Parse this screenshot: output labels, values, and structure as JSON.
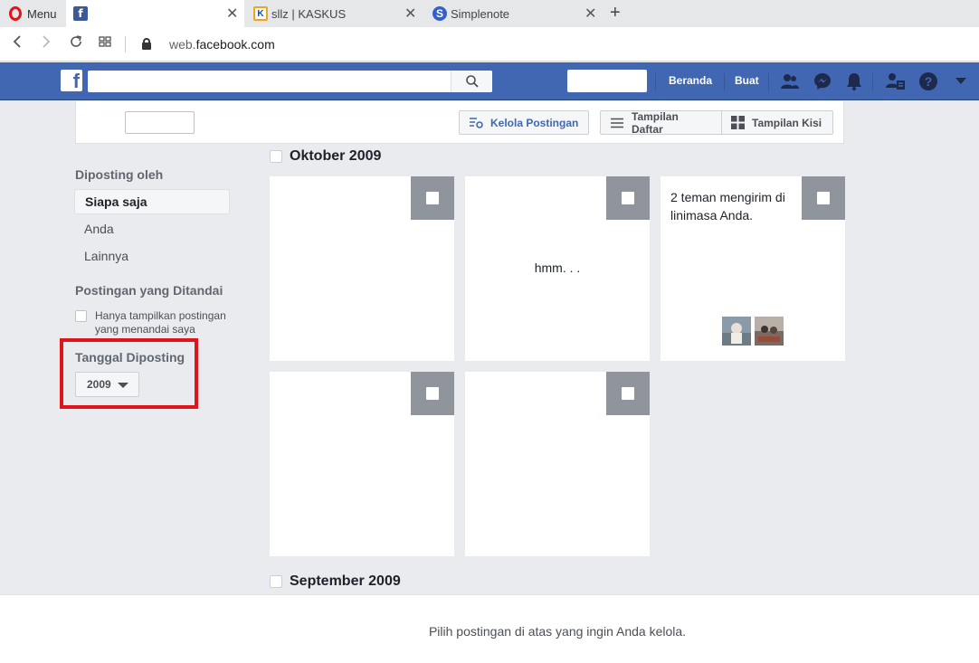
{
  "browser": {
    "menu_label": "Menu",
    "tabs": [
      {
        "label": "",
        "favicon": "facebook-icon"
      },
      {
        "label": "sllz | KASKUS",
        "favicon": "kaskus-icon"
      },
      {
        "label": "Simplenote",
        "favicon": "simplenote-icon"
      }
    ],
    "url_prefix": "web.",
    "url_domain": "facebook.com"
  },
  "fb_header": {
    "logo": "f",
    "search_placeholder": "",
    "home_link": "Beranda",
    "create_link": "Buat",
    "brand_color": "#4267b2"
  },
  "toolbar": {
    "manage_posts": "Kelola Postingan",
    "list_view": "Tampilan Daftar",
    "grid_view": "Tampilan Kisi"
  },
  "sidebar": {
    "posted_by_heading": "Diposting oleh",
    "posted_by_options": [
      "Siapa saja",
      "Anda",
      "Lainnya"
    ],
    "selected_option": "Siapa saja",
    "tagged_heading": "Postingan yang Ditandai",
    "tagged_checkbox_label": "Hanya tampilkan postingan yang menandai saya",
    "date_heading": "Tanggal Diposting",
    "year_value": "2009"
  },
  "months": [
    {
      "label": "Oktober 2009",
      "posts": [
        {
          "text": ""
        },
        {
          "text": "hmm. . ."
        },
        {
          "text": "2 teman mengirim di linimasa Anda."
        },
        {
          "text": ""
        },
        {
          "text": ""
        }
      ]
    },
    {
      "label": "September 2009"
    }
  ],
  "footer": {
    "message": "Pilih postingan di atas yang ingin Anda kelola."
  }
}
